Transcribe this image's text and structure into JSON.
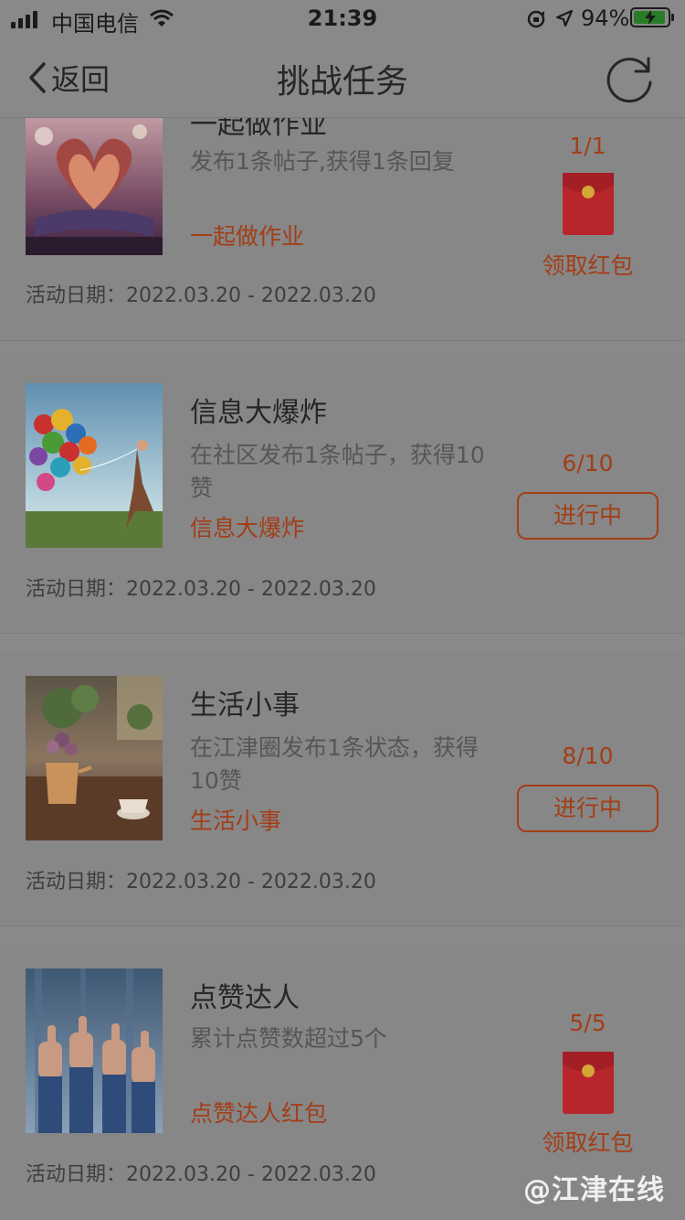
{
  "status_bar": {
    "carrier": "中国电信",
    "time": "21:39",
    "battery_percent": "94%",
    "battery_level": 0.94,
    "icons": [
      "signal-icon",
      "wifi-icon",
      "orientation-lock-icon",
      "location-icon",
      "battery-icon"
    ]
  },
  "nav": {
    "back_label": "返回",
    "title": "挑战任务",
    "refresh_icon": "refresh-icon"
  },
  "tasks": [
    {
      "title": "一起做作业",
      "desc": "发布1条帖子,获得1条回复",
      "tag": "一起做作业",
      "date": "活动日期：2022.03.20 - 2022.03.20",
      "progress": "1/1",
      "action": "领取红包",
      "action_type": "claim",
      "thumb": "book-heart-image"
    },
    {
      "title": "信息大爆炸",
      "desc": "在社区发布1条帖子，获得10赞",
      "tag": "信息大爆炸",
      "date": "活动日期：2022.03.20 - 2022.03.20",
      "progress": "6/10",
      "action": "进行中",
      "action_type": "in-progress",
      "thumb": "balloons-image"
    },
    {
      "title": "生活小事",
      "desc": "在江津圈发布1条状态，获得10赞",
      "tag": "生活小事",
      "date": "活动日期：2022.03.20 - 2022.03.20",
      "progress": "8/10",
      "action": "进行中",
      "action_type": "in-progress",
      "thumb": "flowers-cafe-image"
    },
    {
      "title": "点赞达人",
      "desc": "累计点赞数超过5个",
      "tag": "点赞达人红包",
      "date": "活动日期：2022.03.20 - 2022.03.20",
      "progress": "5/5",
      "action": "领取红包",
      "action_type": "claim",
      "thumb": "thumbs-up-image"
    }
  ],
  "watermark": "@江津在线",
  "colors": {
    "overlay_bg": "#898989",
    "accent": "#a23e17",
    "envelope": "#b8262c",
    "envelope_seal": "#d4a537"
  }
}
